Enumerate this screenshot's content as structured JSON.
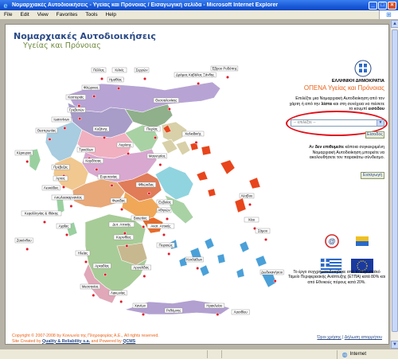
{
  "window": {
    "title": "Νομαρχιακές Αυτοδιοικήσεις - Υγείας και Πρόνοιας / Εισαγωγική σελίδα - Microsoft Internet Explorer",
    "minimize": "_",
    "maximize": "□",
    "close": "×"
  },
  "menu": [
    "File",
    "Edit",
    "View",
    "Favorites",
    "Tools",
    "Help"
  ],
  "site": {
    "title": "Νομαρχιακές Αυτοδιοικήσεις",
    "subtitle": "Υγείας και Πρόνοιας"
  },
  "map": {
    "prefectures": [
      "Έβρου Ροδόπης",
      "Δράμας Καβάλας Ξάνθης",
      "Κιλκίς",
      "Σερρών",
      "Πέλλας",
      "Ημαθίας",
      "Φλώρινας",
      "Καστοριάς",
      "Θεσσαλονίκης",
      "Γρεβενών",
      "Ιωαννίνων",
      "Κοζάνης",
      "Πιερίας",
      "Χαλκιδικής",
      "Θεσπρωτίας",
      "Κέρκυρας",
      "Τρικάλων",
      "Λαρίσης",
      "Μαγνησίας",
      "Πρέβεζας",
      "Καρδίτσας",
      "Ευρυτανίας",
      "Άρτας",
      "Φθιώτιδας",
      "Λευκάδας",
      "Αιτωλοακαρνανίας",
      "Ευβοίας",
      "Λέσβου",
      "Χίου",
      "Φωκίδας",
      "Κεφαλληνίας & Ιθάκης",
      "Αχαΐας",
      "Βοιωτίας",
      "Αθηνών",
      "Δυτ. Αττικής",
      "Ανατ. Αττικής",
      "Πειραιώς",
      "Κορινθίας",
      "Σάμου",
      "Ζακύνθου",
      "Ηλείας",
      "Αρκαδίας",
      "Αργολίδας",
      "Κυκλάδων",
      "Μεσσηνίας",
      "Λακωνίας",
      "Δωδεκανήσου",
      "Χανίων",
      "Ρεθύμνης",
      "Ηρακλείου",
      "Λασιθίου"
    ]
  },
  "panel": {
    "gov_line": "ΕΛΛΗΝΙΚΗ ΔΗΜΟΚΡΑΤΙΑ",
    "org_name": "ΟΠΕΝΑ Υγείας και Πρόνοιας",
    "instructions_1": "Επιλέξτε μια Νομαρχιακή Αυτοδιοίκηση από τον χάρτη ή από την",
    "instructions_list": "λίστα",
    "instructions_2": "και στη συνέχεια να πιέσετε το κουμπί",
    "instructions_enter": "εισόδου",
    "select_placeholder": "-- επιλέξτε --",
    "enter_button": "Είσοδος",
    "register_1": "Αν",
    "register_bold": "δεν επιθυμείτε",
    "register_2": "κάποια συγκεκριμένη Νομαρχιακή Αυτοδιοίκηση μπορείτε να ακολουθήσετε τον παρακάτω σύνδεσμο.",
    "register_button": "Εισαγωγή",
    "funding": "Το έργο συγχρηματοδοτήθηκε από το Ευρωπαϊκό Ταμείο Περιφερειακής Ανάπτυξης (ΕΤΠΑ) κατά 80% και από Εθνικούς πόρους κατά 20%."
  },
  "footer": {
    "copyright": "Copyright © 2007-2008 by Κοινωνία της Πληροφορίας Α.Ε., All rights reserved.",
    "created_prefix": "Site Created by",
    "created_company": "Quality & Reliability s.a.",
    "powered_prefix": "and Powered by",
    "powered_name": "QCMS",
    "terms": "Όροι χρήσης",
    "privacy": "Δήλωση απορρήτου"
  },
  "status": {
    "zone": "Internet"
  },
  "colors": {
    "accent": "#e8621a",
    "navy": "#2a4a86",
    "olive": "#6e8a3e",
    "ring": "#e0101a"
  }
}
